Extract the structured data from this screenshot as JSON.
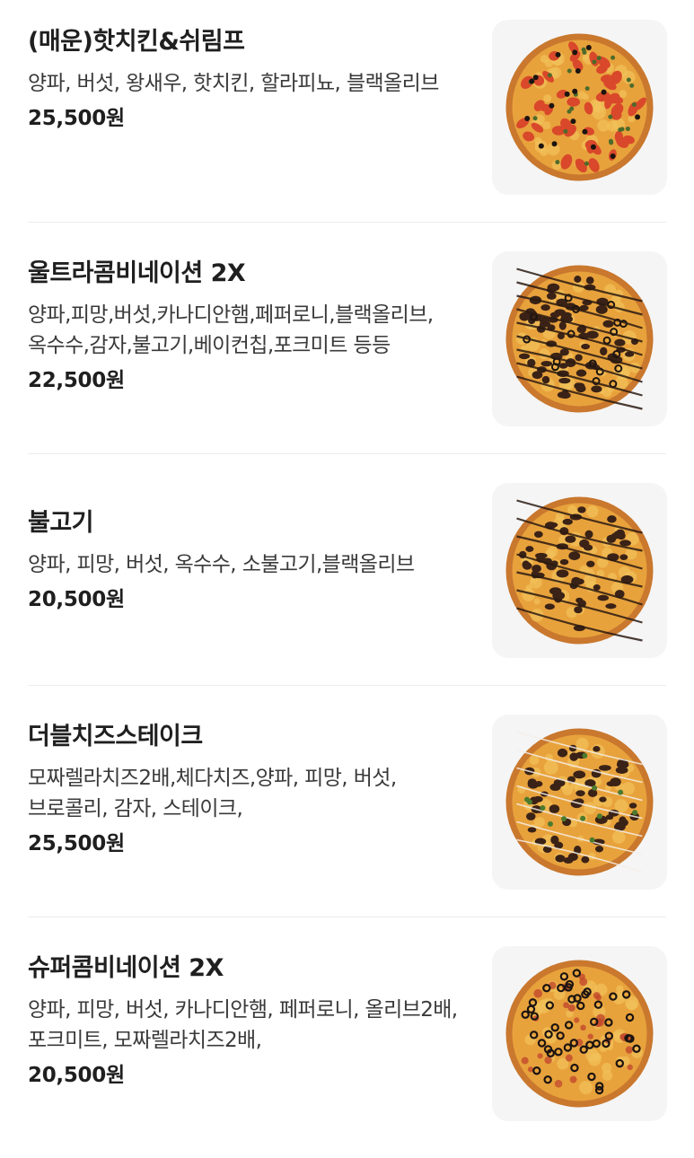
{
  "menu": {
    "items": [
      {
        "name": "(매운)핫치킨&쉬림프",
        "description": "양파, 버섯, 왕새우, 핫치킨, 할라피뇨, 블랙올리브",
        "price": "25,500원",
        "image_icon": "pizza-image",
        "topping": "shrimp"
      },
      {
        "name": "울트라콤비네이션 2X",
        "description": "양파,피망,버섯,카나디안햄,페퍼로니,블랙올리브,옥수수,감자,불고기,베이컨칩,포크미트 등등",
        "price": "22,500원",
        "image_icon": "pizza-image",
        "topping": "combo"
      },
      {
        "name": "불고기",
        "description": "양파, 피망, 버섯, 옥수수, 소불고기,블랙올리브",
        "price": "20,500원",
        "image_icon": "pizza-image",
        "topping": "bulgogi"
      },
      {
        "name": "더블치즈스테이크",
        "description": "모짜렐라치즈2배,체다치즈,양파, 피망, 버섯, 브로콜리, 감자, 스테이크,",
        "price": "25,500원",
        "image_icon": "pizza-image",
        "topping": "steak"
      },
      {
        "name": "슈퍼콤비네이션 2X",
        "description": "양파, 피망, 버섯, 카나디안햄, 페퍼로니, 올리브2배, 포크미트, 모짜렐라치즈2배,",
        "price": "20,500원",
        "image_icon": "pizza-image",
        "topping": "olive"
      }
    ]
  },
  "colors": {
    "crust": "#c9782e",
    "cheese": "#e8a23c",
    "sauce": "#d9482a",
    "olive": "#1c1410",
    "bulgogi": "#3a2216",
    "mayo": "#f4efe6",
    "thumb_bg": "#f5f5f6"
  }
}
